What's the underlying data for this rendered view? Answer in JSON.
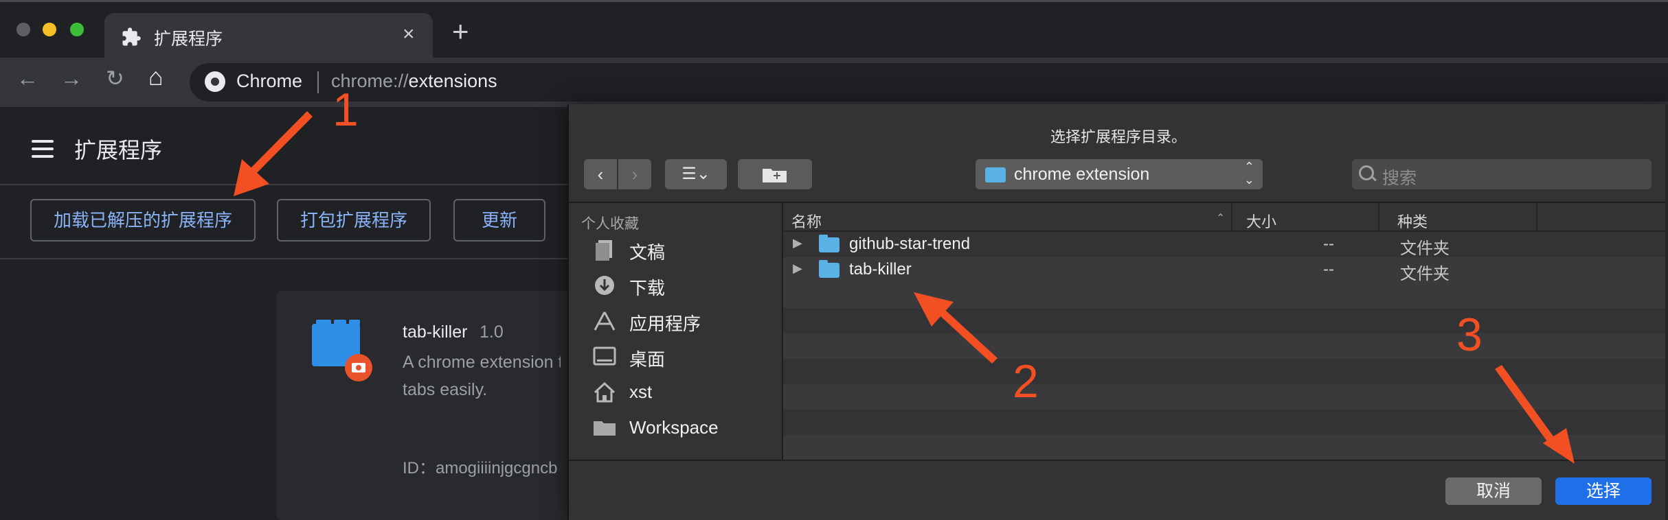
{
  "browser": {
    "tab_icon": "puzzle-icon",
    "tab_title": "扩展程序",
    "tab_close": "×",
    "new_tab": "+",
    "nav": {
      "back": "←",
      "forward": "→",
      "reload": "↻",
      "home": "⌂"
    },
    "omnibox": {
      "origin_label": "Chrome",
      "url_scheme": "chrome://",
      "url_path": "extensions"
    }
  },
  "extensions_page": {
    "title": "扩展程序",
    "buttons": {
      "load_unpacked": "加载已解压的扩展程序",
      "pack": "打包扩展程序",
      "update": "更新"
    },
    "card": {
      "name": "tab-killer",
      "version": "1.0",
      "description_line1": "A chrome extension t",
      "description_line2": "tabs easily.",
      "id_text": "ID：amogiiiinjgcgncb"
    }
  },
  "dialog": {
    "title": "选择扩展程序目录。",
    "toolbar": {
      "back": "‹",
      "forward": "›",
      "view": "☰⌄",
      "new_folder": "+"
    },
    "path_select": "chrome extension",
    "search_placeholder": "搜索",
    "sidebar": {
      "heading": "个人收藏",
      "items": [
        {
          "label": "文稿",
          "icon": "documents-icon"
        },
        {
          "label": "下载",
          "icon": "downloads-icon"
        },
        {
          "label": "应用程序",
          "icon": "applications-icon"
        },
        {
          "label": "桌面",
          "icon": "desktop-icon"
        },
        {
          "label": "xst",
          "icon": "home-icon"
        },
        {
          "label": "Workspace",
          "icon": "folder-icon"
        }
      ]
    },
    "columns": {
      "name": "名称",
      "size": "大小",
      "kind": "种类"
    },
    "files": [
      {
        "name": "github-star-trend",
        "size": "--",
        "kind": "文件夹"
      },
      {
        "name": "tab-killer",
        "size": "--",
        "kind": "文件夹"
      }
    ],
    "buttons": {
      "cancel": "取消",
      "choose": "选择"
    }
  },
  "annotations": [
    "1",
    "2",
    "3"
  ],
  "colors": {
    "accent_link": "#8ab4f8",
    "annotation": "#f25022",
    "choose_button": "#1f6fe8",
    "folder": "#5ab1e4"
  }
}
